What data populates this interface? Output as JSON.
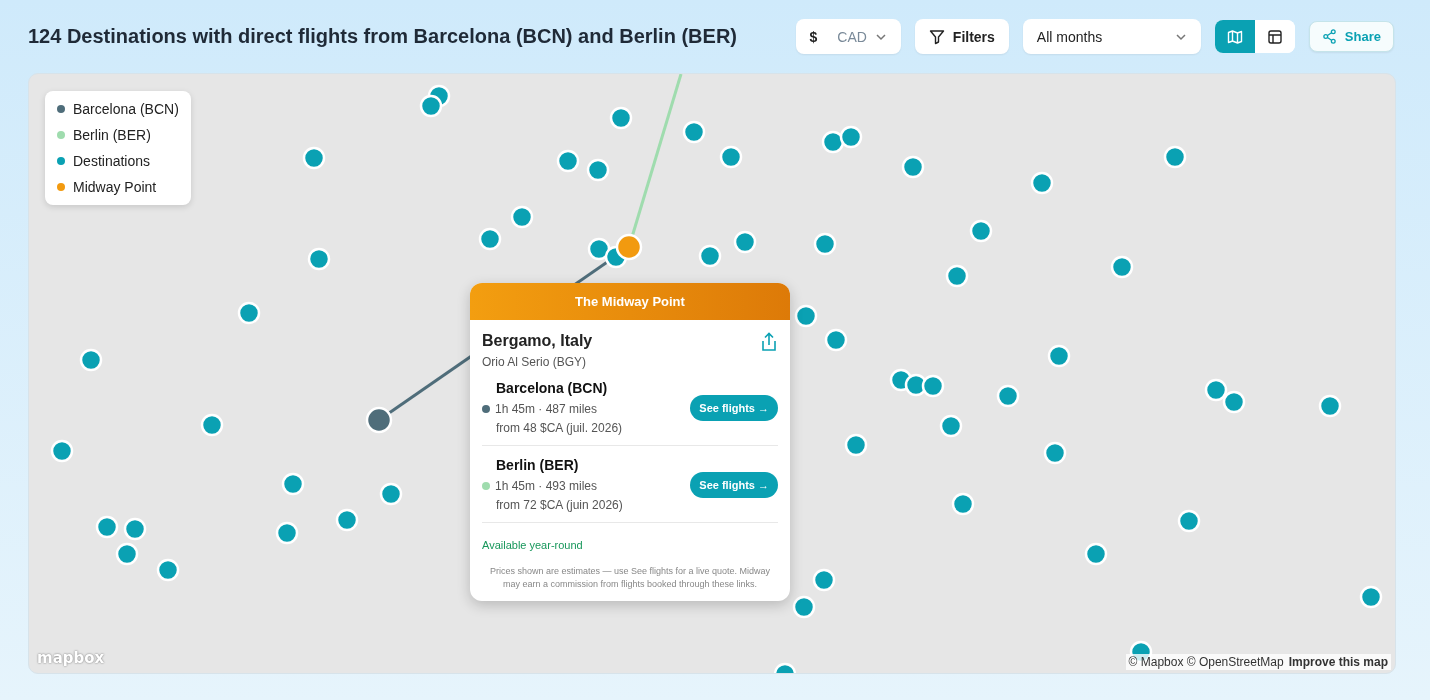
{
  "header": {
    "title": "124 Destinations with direct flights from Barcelona (BCN) and Berlin (BER)"
  },
  "toolbar": {
    "currency": {
      "symbol": "$",
      "code": "CAD"
    },
    "filters": "Filters",
    "months": {
      "value": "All months"
    },
    "view_toggle": [
      {
        "kind": "map",
        "selected": true
      },
      {
        "kind": "table",
        "selected": false
      }
    ],
    "share": "Share"
  },
  "legend": [
    {
      "label": "Barcelona (BCN)",
      "color": "#4f6d7a"
    },
    {
      "label": "Berlin (BER)",
      "color": "#9fdcae"
    },
    {
      "label": "Destinations",
      "color": "#0aa1b3"
    },
    {
      "label": "Midway Point",
      "color": "#f29a0f"
    }
  ],
  "popup": {
    "banner": "The Midway Point",
    "city": "Bergamo, Italy",
    "airport": "Orio Al Serio (BGY)",
    "origins": [
      {
        "name": "Barcelona (BCN)",
        "color": "#4f6d7a",
        "duration": "1h 45m · 487 miles",
        "price": "from 48 $CA (juil. 2026)",
        "button": "See flights →"
      },
      {
        "name": "Berlin (BER)",
        "color": "#9fdcae",
        "duration": "1h 45m · 493 miles",
        "price": "from 72 $CA (juin 2026)",
        "button": "See flights →"
      }
    ],
    "availability": "Available year-round",
    "disclaimer": "Prices shown are estimates — use See flights for a live quote. Midway may earn a commission from flights booked through these links."
  },
  "map": {
    "logo": "mapbox",
    "attribution": "© Mapbox © OpenStreetMap",
    "improve_link": "Improve this map"
  }
}
